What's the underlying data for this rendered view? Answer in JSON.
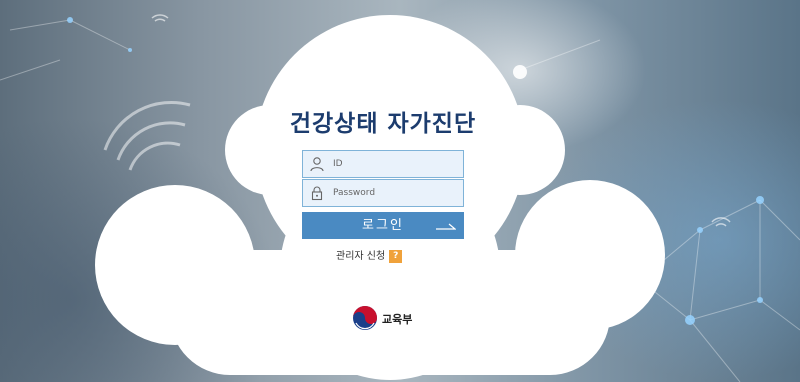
{
  "title": "건강상태 자가진단",
  "login_form": {
    "id_placeholder": "ID",
    "password_placeholder": "Password",
    "login_button": "로그인"
  },
  "admin_link": {
    "label": "관리자 신청",
    "help_badge": "?"
  },
  "ministry": {
    "name": "교육부"
  },
  "icons": {
    "id_field": "user-icon",
    "password_field": "lock-icon",
    "login_button": "arrow-right-icon",
    "emblem": "taegeuk-emblem-icon",
    "background": [
      "wifi-icon",
      "network-node-icon"
    ]
  },
  "colors": {
    "title": "#1c3c6e",
    "button": "#4a8ac2",
    "field_bg": "#e9f2fb",
    "field_border": "#7fb3d8",
    "help_badge": "#f0a23b"
  }
}
